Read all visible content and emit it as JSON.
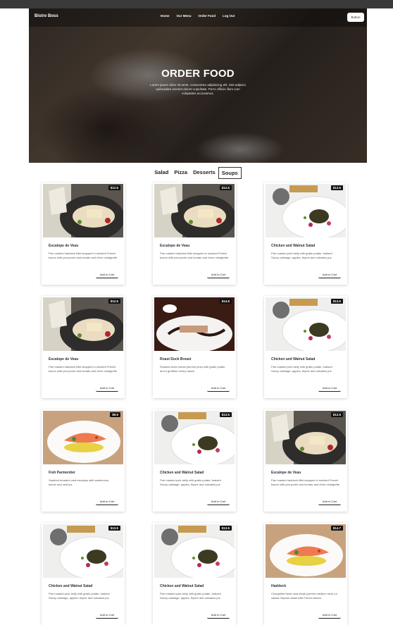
{
  "brand": "Bistro Boss",
  "nav": {
    "links": [
      "Home",
      "Our Menu",
      "Order Food",
      "Log Out"
    ],
    "button": "Button"
  },
  "hero": {
    "title": "ORDER FOOD",
    "subtitle": "Lorem ipsum dolor sit amet, consectetur adipisicing elit. Sint adipisci quibusdam eveniet dolore cupiditate. Porro officiis illum cum voluptates accusamus."
  },
  "tabs": [
    "Salad",
    "Pizza",
    "Desserts",
    "Soups"
  ],
  "active_tab": "Soups",
  "cart_label": "Add to Cart",
  "items": [
    {
      "name": "Escalope de Veau",
      "price": "$12.5",
      "desc": "Pan roasted haddock fillet wrapped in smoked French bacon with pea purée and tomato and chive vinaigrette",
      "image": "veau-plate"
    },
    {
      "name": "Escalope de Veau",
      "price": "$12.5",
      "desc": "Pan roasted haddock fillet wrapped in smoked French bacon with pea purée and tomato and chive vinaigrette",
      "image": "veau-plate"
    },
    {
      "name": "Chicken and Walnut Salad",
      "price": "$13.5",
      "desc": "Pan roasted pork belly with gratin potato, braised Savoy cabbage, apples, thyme and calvados jus",
      "image": "walnut-salad-plate"
    },
    {
      "name": "Escalope de Veau",
      "price": "$12.5",
      "desc": "Pan roasted haddock fillet wrapped in smoked French bacon with pea purée and tomato and chive vinaigrette",
      "image": "veau-plate"
    },
    {
      "name": "Roast Duck Breast",
      "price": "$14.5",
      "desc": "Roasted duck breast (served pink) with gratin potato and a griottine cherry sauce",
      "image": "duck-plate"
    },
    {
      "name": "Chicken and Walnut Salad",
      "price": "$13.5",
      "desc": "Pan roasted pork belly with gratin potato, braised Savoy cabbage, apples, thyme and calvados jus",
      "image": "walnut-salad-plate"
    },
    {
      "name": "Fish Parmentier",
      "price": "$9.5",
      "desc": "Sautéed breaded veal escalope with watercress, lemon and veal jus.",
      "image": "salmon-plate"
    },
    {
      "name": "Chicken and Walnut Salad",
      "price": "$13.5",
      "desc": "Pan roasted pork belly with gratin potato, braised Savoy cabbage, apples, thyme and calvados jus",
      "image": "walnut-salad-plate"
    },
    {
      "name": "Escalope de Veau",
      "price": "$12.5",
      "desc": "Pan roasted haddock fillet wrapped in smoked French bacon with pea purée and tomato and chive vinaigrette",
      "image": "veau-plate"
    },
    {
      "name": "Chicken and Walnut Salad",
      "price": "$13.5",
      "desc": "Pan roasted pork belly with gratin potato, braised Savoy cabbage, apples, thyme and calvados jus",
      "image": "walnut-salad-plate"
    },
    {
      "name": "Chicken and Walnut Salad",
      "price": "$13.5",
      "desc": "Pan roasted pork belly with gratin potato, braised Savoy cabbage, apples, thyme and calvados jus",
      "image": "walnut-salad-plate"
    },
    {
      "name": "Haddock",
      "price": "$14.7",
      "desc": "Chargrilled fresh tuna steak (served medium rare) on classic Niçoise salad with French beans.",
      "image": "salmon-plate"
    }
  ]
}
